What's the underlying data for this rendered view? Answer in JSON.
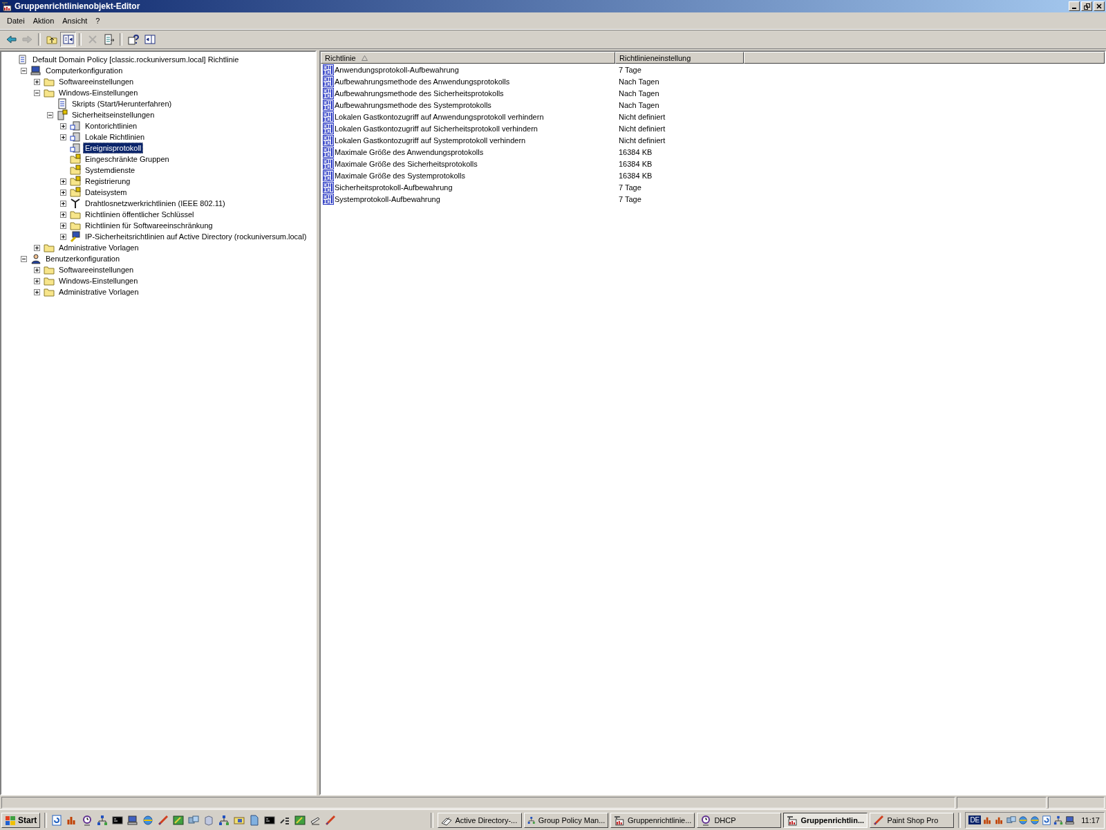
{
  "window": {
    "title": "Gruppenrichtlinienobjekt-Editor"
  },
  "menu": [
    "Datei",
    "Aktion",
    "Ansicht",
    "?"
  ],
  "toolbar": [
    {
      "kind": "back",
      "disabled": false,
      "pressed": false
    },
    {
      "kind": "forward",
      "disabled": true,
      "pressed": false
    },
    {
      "kind": "separator"
    },
    {
      "kind": "up",
      "disabled": false,
      "pressed": false
    },
    {
      "kind": "tree",
      "disabled": false,
      "pressed": true
    },
    {
      "kind": "separator"
    },
    {
      "kind": "delete",
      "disabled": true,
      "pressed": false
    },
    {
      "kind": "export",
      "disabled": false,
      "pressed": false
    },
    {
      "kind": "separator"
    },
    {
      "kind": "help",
      "disabled": false,
      "pressed": false
    },
    {
      "kind": "panel",
      "disabled": false,
      "pressed": false
    }
  ],
  "tree": [
    {
      "label": "Default Domain Policy [classic.rockuniversum.local] Richtlinie",
      "kind": "root",
      "selected": false,
      "children": [
        {
          "label": "Computerkonfiguration",
          "kind": "computer",
          "expanded": true,
          "selected": false,
          "children": [
            {
              "label": "Softwareeinstellungen",
              "kind": "folder",
              "expanded": false,
              "selected": false
            },
            {
              "label": "Windows-Einstellungen",
              "kind": "folder",
              "expanded": true,
              "selected": false,
              "children": [
                {
                  "label": "Skripts (Start/Herunterfahren)",
                  "kind": "script",
                  "selected": false
                },
                {
                  "label": "Sicherheitseinstellungen",
                  "kind": "security",
                  "expanded": true,
                  "selected": false,
                  "children": [
                    {
                      "label": "Kontorichtlinien",
                      "kind": "policy",
                      "expanded": false,
                      "selected": false
                    },
                    {
                      "label": "Lokale Richtlinien",
                      "kind": "policy",
                      "expanded": false,
                      "selected": false
                    },
                    {
                      "label": "Ereignisprotokoll",
                      "kind": "policy",
                      "selected": true
                    },
                    {
                      "label": "Eingeschränkte Gruppen",
                      "kind": "lockfolder",
                      "selected": false
                    },
                    {
                      "label": "Systemdienste",
                      "kind": "lockfolder",
                      "selected": false
                    },
                    {
                      "label": "Registrierung",
                      "kind": "lockfolder",
                      "expanded": false,
                      "selected": false
                    },
                    {
                      "label": "Dateisystem",
                      "kind": "lockfolder",
                      "expanded": false,
                      "selected": false
                    },
                    {
                      "label": "Drahtlosnetzwerkrichtlinien (IEEE 802.11)",
                      "kind": "wireless",
                      "expanded": false,
                      "selected": false
                    },
                    {
                      "label": "Richtlinien öffentlicher Schlüssel",
                      "kind": "folder",
                      "expanded": false,
                      "selected": false
                    },
                    {
                      "label": "Richtlinien für Softwareeinschränkung",
                      "kind": "folder",
                      "expanded": false,
                      "selected": false
                    },
                    {
                      "label": "IP-Sicherheitsrichtlinien auf Active Directory (rockuniversum.local)",
                      "kind": "ipsec",
                      "expanded": false,
                      "selected": false
                    }
                  ]
                }
              ]
            },
            {
              "label": "Administrative Vorlagen",
              "kind": "folder",
              "expanded": false,
              "selected": false
            }
          ]
        },
        {
          "label": "Benutzerkonfiguration",
          "kind": "user",
          "expanded": true,
          "selected": false,
          "children": [
            {
              "label": "Softwareeinstellungen",
              "kind": "folder",
              "expanded": false,
              "selected": false
            },
            {
              "label": "Windows-Einstellungen",
              "kind": "folder",
              "expanded": false,
              "selected": false
            },
            {
              "label": "Administrative Vorlagen",
              "kind": "folder",
              "expanded": false,
              "selected": false
            }
          ]
        }
      ]
    }
  ],
  "table": {
    "columns": [
      {
        "label": "Richtlinie",
        "sorted": true
      },
      {
        "label": "Richtlinieneinstellung",
        "sorted": false
      }
    ],
    "rows": [
      [
        "Anwendungsprotokoll-Aufbewahrung",
        "7 Tage"
      ],
      [
        "Aufbewahrungsmethode des Anwendungsprotokolls",
        "Nach Tagen"
      ],
      [
        "Aufbewahrungsmethode des Sicherheitsprotokolls",
        "Nach Tagen"
      ],
      [
        "Aufbewahrungsmethode des Systemprotokolls",
        "Nach Tagen"
      ],
      [
        "Lokalen Gastkontozugriff auf Anwendungsprotokoll verhindern",
        "Nicht definiert"
      ],
      [
        "Lokalen Gastkontozugriff auf Sicherheitsprotokoll verhindern",
        "Nicht definiert"
      ],
      [
        "Lokalen Gastkontozugriff auf Systemprotokoll verhindern",
        "Nicht definiert"
      ],
      [
        "Maximale Größe des Anwendungsprotokolls",
        "16384 KB"
      ],
      [
        "Maximale Größe des Sicherheitsprotokolls",
        "16384 KB"
      ],
      [
        "Maximale Größe des Systemprotokolls",
        "16384 KB"
      ],
      [
        "Sicherheitsprotokoll-Aufbewahrung",
        "7 Tage"
      ],
      [
        "Systemprotokoll-Aufbewahrung",
        "7 Tage"
      ]
    ]
  },
  "taskbar": {
    "start": "Start",
    "tasks": [
      {
        "label": "Active Directory-...",
        "kind": "book",
        "selected": false
      },
      {
        "label": "Group Policy Man...",
        "kind": "tree",
        "selected": false
      },
      {
        "label": "Gruppenrichtlinie...",
        "kind": "gpe",
        "selected": false
      },
      {
        "label": "DHCP",
        "kind": "clock",
        "selected": false
      },
      {
        "label": "Gruppenrichtlin...",
        "kind": "gpe",
        "selected": true
      },
      {
        "label": "Paint Shop Pro",
        "kind": "brush",
        "selected": false
      }
    ],
    "language": "DE",
    "clock": "11:17"
  }
}
